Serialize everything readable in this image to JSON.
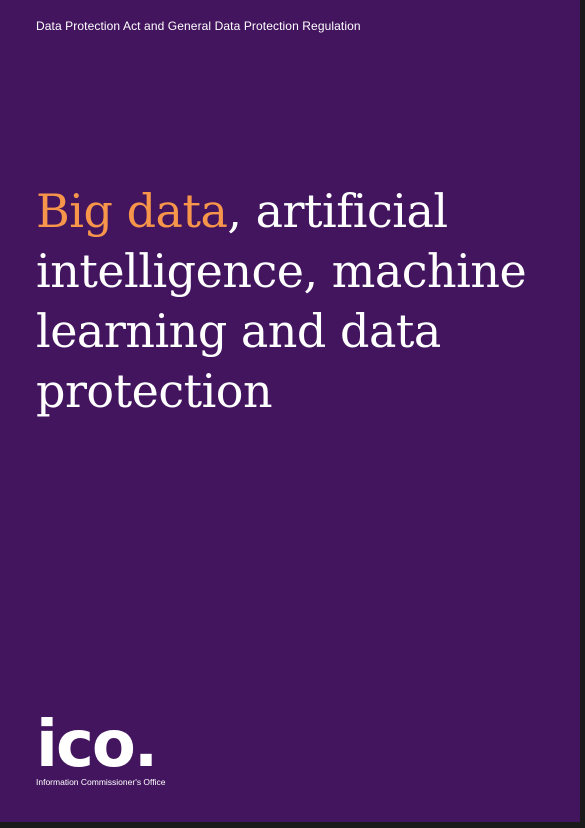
{
  "header": {
    "subtitle": "Data Protection Act and General Data Protection Regulation"
  },
  "title": {
    "highlight": "Big data",
    "line1_rest": ", artificial",
    "line2": "intelligence, machine",
    "line3": "learning and data",
    "line4": "protection"
  },
  "logo": {
    "mark": "ico.",
    "name": "Information Commissioner's Office"
  },
  "colors": {
    "background": "#42155e",
    "accent": "#f7954a",
    "text": "#ffffff"
  }
}
